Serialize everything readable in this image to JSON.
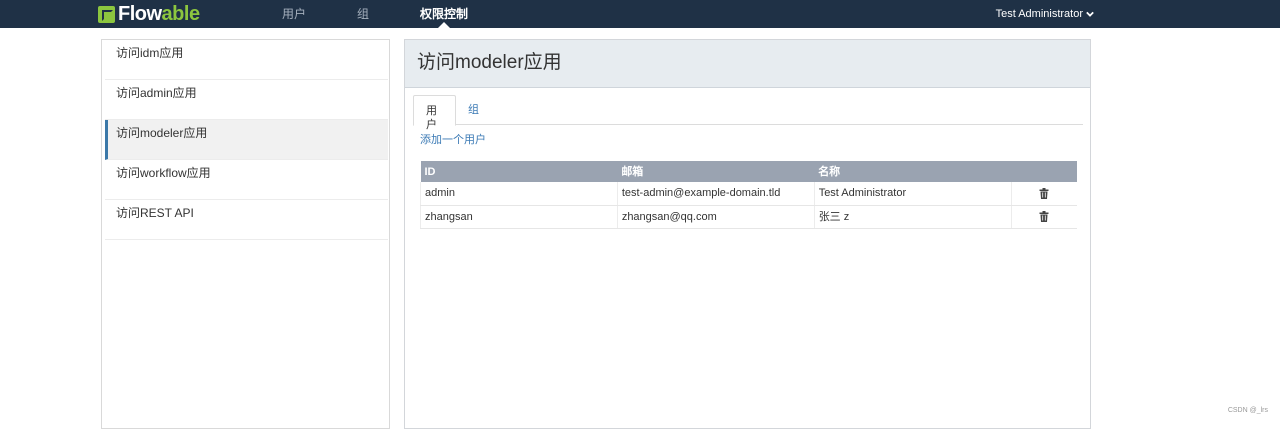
{
  "app": {
    "logo_prefix": "Flow",
    "logo_accent": "able",
    "brand_color": "#8cc63f",
    "topbar_color": "#1f3146"
  },
  "nav": {
    "items": [
      {
        "label": "用户",
        "active": false
      },
      {
        "label": "组",
        "active": false
      },
      {
        "label": "权限控制",
        "active": true
      }
    ],
    "user_menu": "Test Administrator",
    "user_menu_icon": "chevron-down-icon"
  },
  "sidebar": {
    "items": [
      {
        "label": "访问idm应用",
        "active": false
      },
      {
        "label": "访问admin应用",
        "active": false
      },
      {
        "label": "访问modeler应用",
        "active": true
      },
      {
        "label": "访问workflow应用",
        "active": false
      },
      {
        "label": "访问REST API",
        "active": false
      }
    ]
  },
  "main": {
    "title": "访问modeler应用",
    "tabs": [
      {
        "label": "用户",
        "active": true
      },
      {
        "label": "组",
        "active": false
      }
    ],
    "add_user_link": "添加一个用户",
    "table": {
      "columns": [
        "ID",
        "邮箱",
        "名称",
        ""
      ],
      "rows": [
        {
          "id": "admin",
          "email": "test-admin@example-domain.tld",
          "name": "Test Administrator",
          "action_icon": "trash-icon"
        },
        {
          "id": "zhangsan",
          "email": "zhangsan@qq.com",
          "name": "张三 z",
          "action_icon": "trash-icon"
        }
      ]
    }
  },
  "watermark": "CSDN @_lrs"
}
